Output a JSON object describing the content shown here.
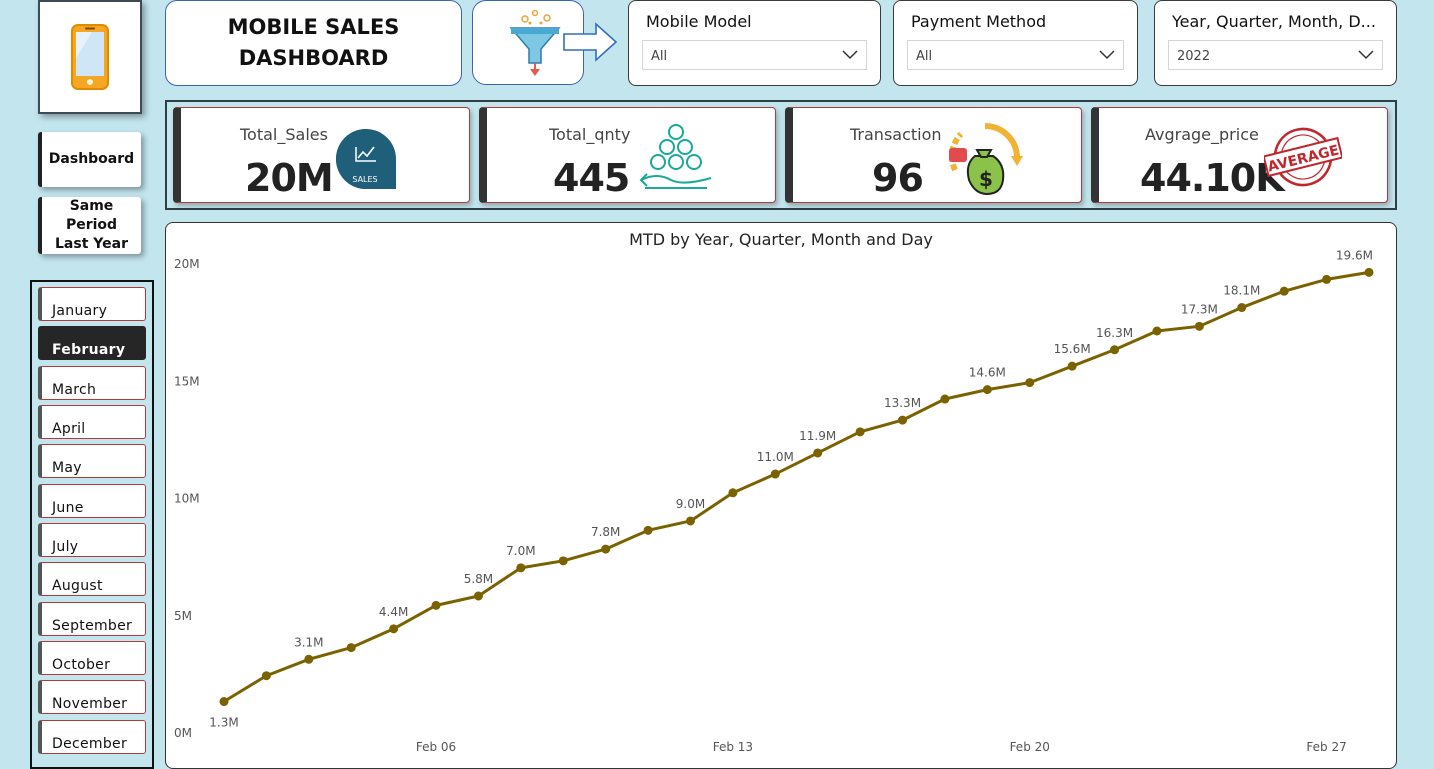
{
  "header": {
    "title": "MOBILE  SALES\nDASHBOARD"
  },
  "nav": {
    "dashboard_label": "Dashboard",
    "same_period_label": "Same Period\nLast Year"
  },
  "slicers": {
    "mobile_model": {
      "title": "Mobile Model",
      "value": "All"
    },
    "payment_method": {
      "title": "Payment Method",
      "value": "All"
    },
    "date": {
      "title": "Year, Quarter, Month, D...",
      "value": "2022"
    }
  },
  "kpis": [
    {
      "label": "Total_Sales",
      "value": "20M",
      "icon": "sales-chart-icon"
    },
    {
      "label": "Total_qnty",
      "value": "445",
      "icon": "stacked-coins-icon"
    },
    {
      "label": "Transaction",
      "value": "96",
      "icon": "money-bag-exchange-icon"
    },
    {
      "label": "Avgrage_price",
      "value": "44.10K",
      "icon": "average-stamp-icon",
      "icon_text": "AVERAGE"
    }
  ],
  "kpi_icon_text": {
    "sales": "SALES"
  },
  "months": [
    "January",
    "February",
    "March",
    "April",
    "May",
    "June",
    "July",
    "August",
    "September",
    "October",
    "November",
    "December"
  ],
  "selected_month": "February",
  "colors": {
    "background": "#c3e5ee",
    "line": "#7a6200",
    "active_month": "#262626",
    "sales_icon": "#1f5f7a",
    "coins_icon": "#1aa89a",
    "stamp": "#c0272d"
  },
  "chart_data": {
    "type": "line",
    "title": "MTD by Year, Quarter, Month and Day",
    "xlabel": "",
    "ylabel": "",
    "ylim": [
      0,
      20
    ],
    "y_unit": "M",
    "y_ticks": [
      "0M",
      "5M",
      "10M",
      "15M",
      "20M"
    ],
    "x_ticks": [
      {
        "day": 6,
        "label": "Feb 06"
      },
      {
        "day": 13,
        "label": "Feb 13"
      },
      {
        "day": 20,
        "label": "Feb 20"
      },
      {
        "day": 27,
        "label": "Feb 27"
      }
    ],
    "x_range": [
      1,
      28
    ],
    "points": [
      {
        "day": 1,
        "value": 1.3,
        "label": "1.3M"
      },
      {
        "day": 2,
        "value": 2.4,
        "label": ""
      },
      {
        "day": 3,
        "value": 3.1,
        "label": "3.1M"
      },
      {
        "day": 4,
        "value": 3.6,
        "label": ""
      },
      {
        "day": 5,
        "value": 4.4,
        "label": "4.4M"
      },
      {
        "day": 6,
        "value": 5.4,
        "label": ""
      },
      {
        "day": 7,
        "value": 5.8,
        "label": "5.8M"
      },
      {
        "day": 8,
        "value": 7.0,
        "label": "7.0M"
      },
      {
        "day": 9,
        "value": 7.3,
        "label": ""
      },
      {
        "day": 10,
        "value": 7.8,
        "label": "7.8M"
      },
      {
        "day": 11,
        "value": 8.6,
        "label": ""
      },
      {
        "day": 12,
        "value": 9.0,
        "label": "9.0M"
      },
      {
        "day": 13,
        "value": 10.2,
        "label": ""
      },
      {
        "day": 14,
        "value": 11.0,
        "label": "11.0M"
      },
      {
        "day": 15,
        "value": 11.9,
        "label": "11.9M"
      },
      {
        "day": 16,
        "value": 12.8,
        "label": ""
      },
      {
        "day": 17,
        "value": 13.3,
        "label": "13.3M"
      },
      {
        "day": 18,
        "value": 14.2,
        "label": ""
      },
      {
        "day": 19,
        "value": 14.6,
        "label": "14.6M"
      },
      {
        "day": 20,
        "value": 14.9,
        "label": ""
      },
      {
        "day": 21,
        "value": 15.6,
        "label": "15.6M"
      },
      {
        "day": 22,
        "value": 16.3,
        "label": "16.3M"
      },
      {
        "day": 23,
        "value": 17.1,
        "label": ""
      },
      {
        "day": 24,
        "value": 17.3,
        "label": "17.3M"
      },
      {
        "day": 25,
        "value": 18.1,
        "label": "18.1M"
      },
      {
        "day": 26,
        "value": 18.8,
        "label": ""
      },
      {
        "day": 27,
        "value": 19.3,
        "label": ""
      },
      {
        "day": 28,
        "value": 19.6,
        "label": "19.6M"
      }
    ]
  }
}
